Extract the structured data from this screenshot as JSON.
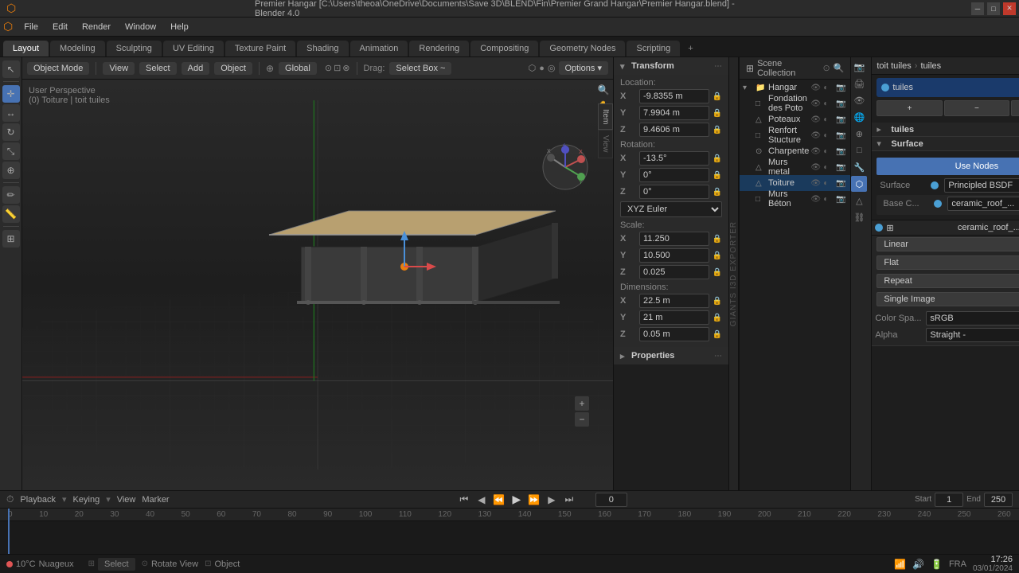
{
  "titlebar": {
    "title": "Premier Hangar [C:\\Users\\theoa\\OneDrive\\Documents\\Save 3D\\BLEND\\Fin\\Premier Grand Hangar\\Premier Hangar.blend] - Blender 4.0",
    "controls": [
      "_",
      "□",
      "✕"
    ]
  },
  "menubar": {
    "items": [
      "File",
      "Edit",
      "Render",
      "Window",
      "Help"
    ],
    "active": "Layout"
  },
  "workspace_tabs": {
    "tabs": [
      "Layout",
      "Modeling",
      "Sculpting",
      "UV Editing",
      "Texture Paint",
      "Shading",
      "Animation",
      "Rendering",
      "Compositing",
      "Geometry Nodes",
      "Scripting"
    ],
    "active": "Layout",
    "addon": "+"
  },
  "viewport": {
    "header": {
      "object_mode": "Object Mode",
      "view": "View",
      "select": "Select",
      "add": "Add",
      "object": "Object",
      "orientation": "Global",
      "drag": "Drag:",
      "drag_mode": "Select Box ~",
      "options": "Options ▾"
    },
    "info": {
      "perspective": "User Perspective",
      "selected": "(0) Toiture | toit tuiles"
    }
  },
  "transform": {
    "title": "Transform",
    "location": {
      "label": "Location:",
      "x": "-9.8355 m",
      "y": "7.9904 m",
      "z": "9.4606 m"
    },
    "rotation": {
      "label": "Rotation:",
      "x": "-13.5°",
      "y": "0°",
      "z": "0°",
      "mode": "XYZ Euler"
    },
    "scale": {
      "label": "Scale:",
      "x": "11.250",
      "y": "10.500",
      "z": "0.025"
    },
    "dimensions": {
      "label": "Dimensions:",
      "x": "22.5 m",
      "y": "21 m",
      "z": "0.05 m"
    }
  },
  "properties_section": {
    "title": "Properties"
  },
  "outliner": {
    "title": "Scene Collection",
    "items": [
      {
        "name": "Hangar",
        "level": 0,
        "icon": "▾",
        "visible": true
      },
      {
        "name": "Fondation des Poto",
        "level": 1,
        "icon": "□",
        "visible": true
      },
      {
        "name": "Poteaux",
        "level": 1,
        "icon": "△",
        "visible": true
      },
      {
        "name": "Renfort Stucture",
        "level": 1,
        "icon": "□",
        "visible": true
      },
      {
        "name": "Charpente",
        "level": 1,
        "icon": "⊙",
        "visible": true
      },
      {
        "name": "Murs metal",
        "level": 1,
        "icon": "△",
        "visible": true
      },
      {
        "name": "Toiture",
        "level": 1,
        "icon": "△",
        "selected": true,
        "visible": true
      },
      {
        "name": "Murs Béton",
        "level": 1,
        "icon": "□",
        "visible": true
      }
    ]
  },
  "material": {
    "breadcrumb_root": "toit tuiles",
    "breadcrumb_arrow": ">",
    "breadcrumb_mat": "tuiles",
    "active_material": "tuiles",
    "dot_color": "#4a9fd4",
    "use_nodes_btn": "Use Nodes",
    "surface_label": "Surface",
    "surface_shader": "Principled BSDF",
    "surface_dot": "#4a9fd4",
    "base_color_label": "Base C...",
    "base_color_mat": "ceramic_roof_...",
    "texture_name": "ceramic_roof_...",
    "linear_label": "Linear",
    "flat_label": "Flat",
    "repeat_label": "Repeat",
    "single_image_label": "Single Image",
    "color_space_label": "Color Spa...",
    "color_space_value": "sRGB",
    "alpha_label": "Alpha",
    "alpha_value": "Straight -"
  },
  "timeline": {
    "header": {
      "playback": "Playback",
      "keying": "Keying",
      "view": "View",
      "marker": "Marker"
    },
    "frame_current": "0",
    "start": "1",
    "end": "250",
    "start_label": "Start",
    "end_label": "End",
    "marks": [
      "0",
      "10",
      "20",
      "30",
      "40",
      "50",
      "60",
      "70",
      "80",
      "90",
      "100",
      "110",
      "120",
      "130",
      "140",
      "150",
      "160",
      "170",
      "180",
      "190",
      "200",
      "210",
      "220",
      "230",
      "240",
      "250",
      "260"
    ]
  },
  "statusbar": {
    "select_label": "Select",
    "rotate_label": "Rotate View",
    "object_label": "Object",
    "temp": "10°C",
    "weather": "Nuageux",
    "language": "FRA",
    "time": "17:26",
    "date": "03/01/2024"
  },
  "sidebar_right": {
    "item_tab": "Item",
    "view_tab": "View"
  },
  "giant_text": "GIANTS I3D EXPORTER"
}
